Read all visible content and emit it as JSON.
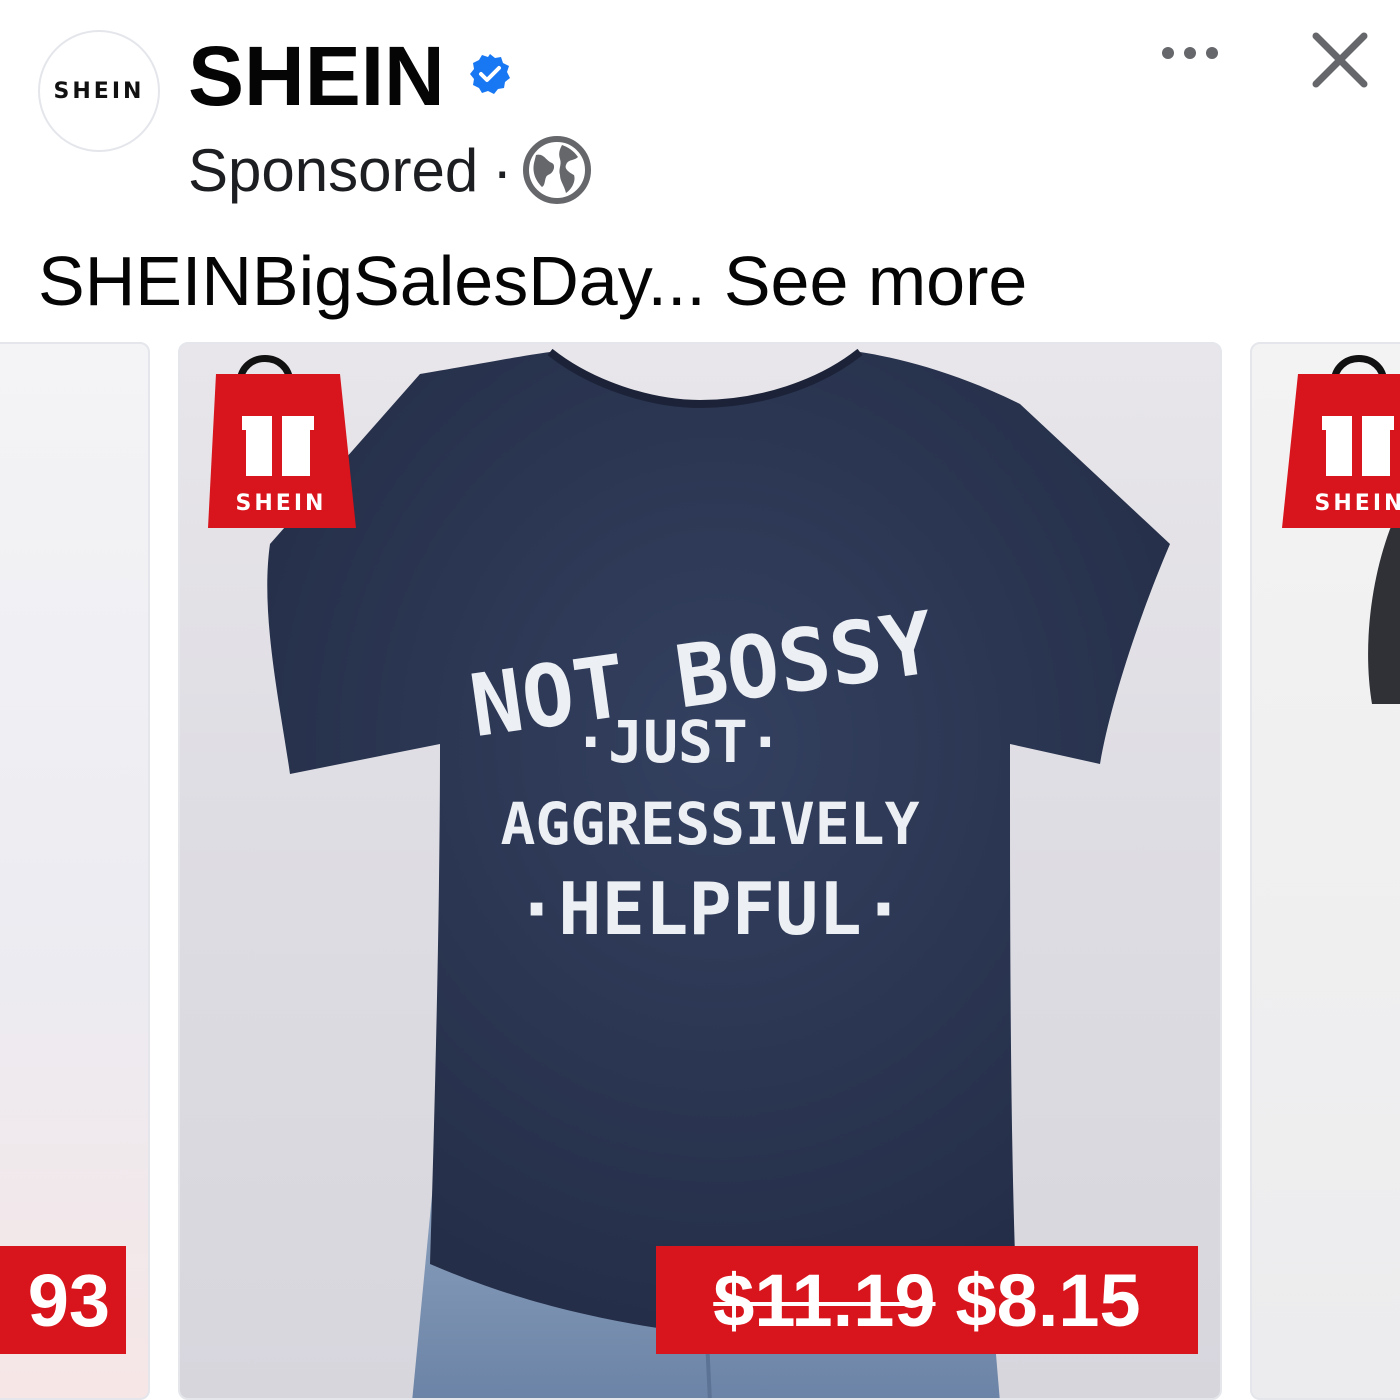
{
  "post": {
    "avatar_text": "SHEIN",
    "page_name": "SHEIN",
    "sponsored_label": "Sponsored",
    "separator": "·",
    "caption": "SHEINBigSalesDay...",
    "see_more_label": "See more"
  },
  "icons": {
    "verified": "verified-badge-icon",
    "audience": "globe-icon",
    "more": "more-options-icon",
    "close": "close-icon",
    "shopping_bag": "shopping-bag-icon"
  },
  "carousel": {
    "cards": [
      {
        "position": "previous",
        "price_label": "93"
      },
      {
        "position": "current",
        "bag_label": "SHEIN",
        "shirt_text": [
          "NOT BOSSY",
          "·JUST·",
          "AGGRESSIVELY",
          "·HELPFUL·"
        ],
        "old_price": "$11.19",
        "new_price": "$8.15"
      },
      {
        "position": "next",
        "bag_label": "SHEIN"
      }
    ]
  },
  "colors": {
    "brand_red": "#d8141c",
    "verified_blue": "#1877f2",
    "shirt_navy": "#2a3552",
    "jeans_blue": "#7e95b3",
    "text_primary": "#050505",
    "icon_gray": "#65676b"
  }
}
